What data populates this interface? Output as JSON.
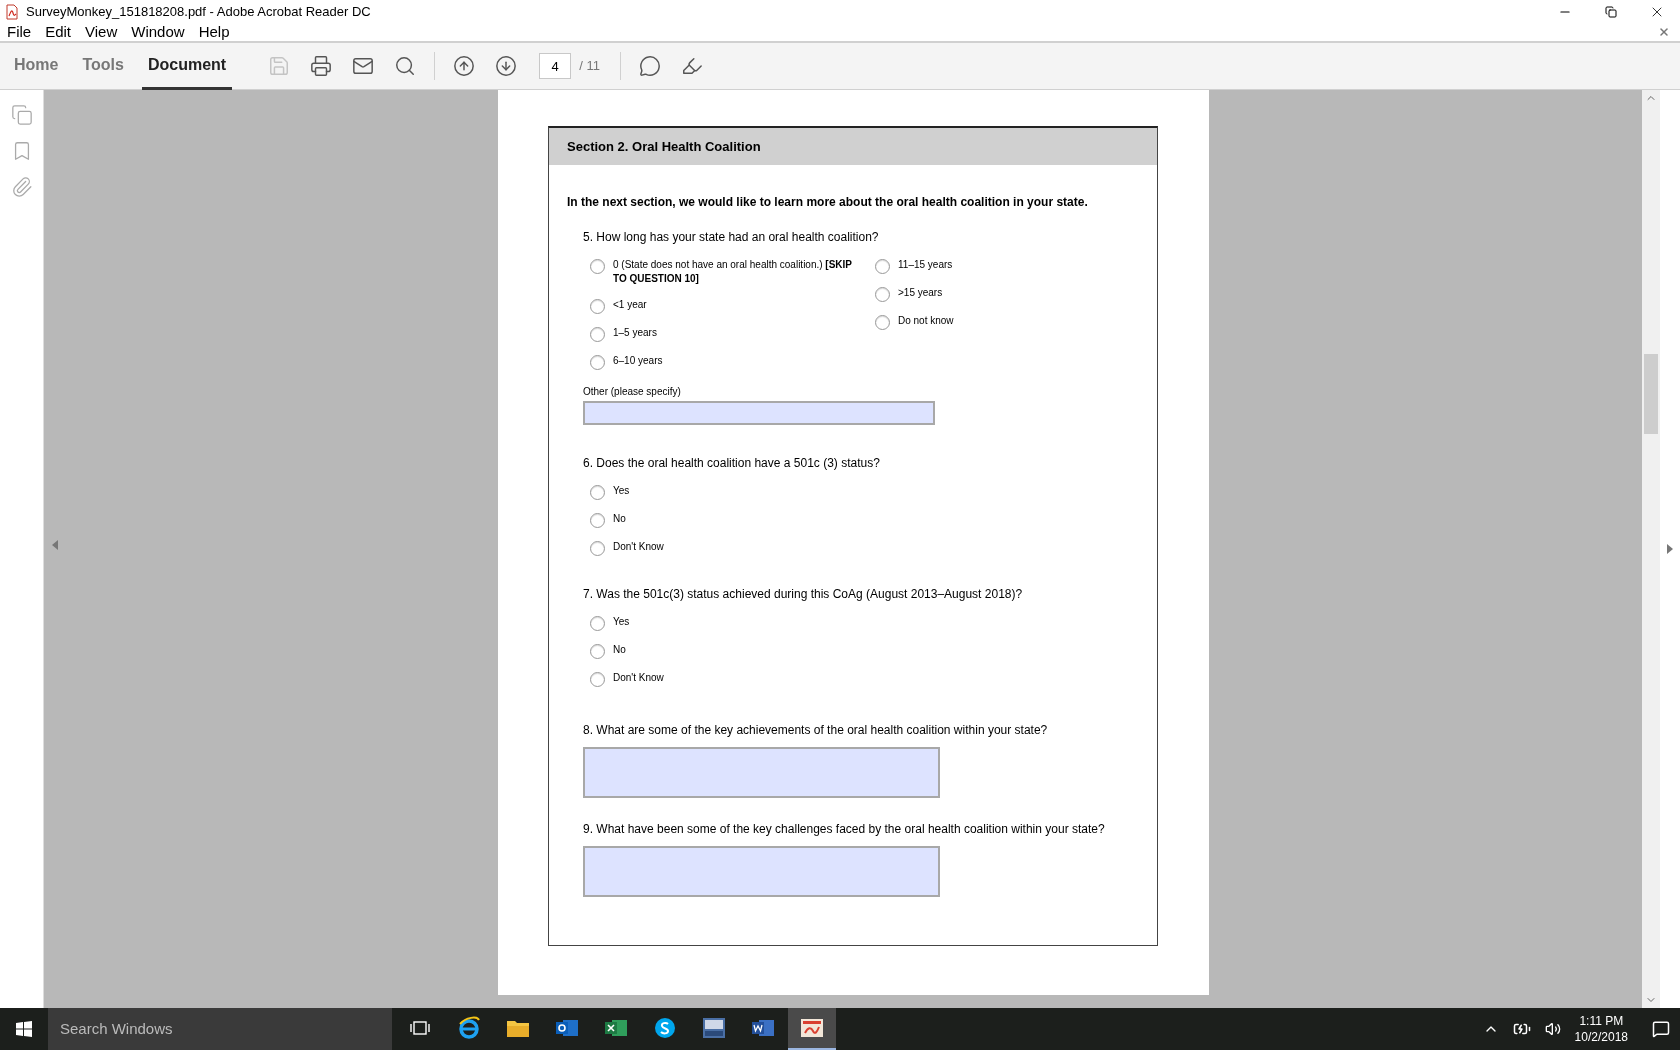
{
  "window": {
    "title": "SurveyMonkey_151818208.pdf - Adobe Acrobat Reader DC"
  },
  "menu": [
    "File",
    "Edit",
    "View",
    "Window",
    "Help"
  ],
  "tabs": [
    {
      "label": "Home",
      "selected": false
    },
    {
      "label": "Tools",
      "selected": false
    },
    {
      "label": "Document",
      "selected": true
    }
  ],
  "tools": [
    {
      "kind": "save",
      "disabled": true
    },
    {
      "kind": "print",
      "disabled": false
    },
    {
      "kind": "mail",
      "disabled": false
    },
    {
      "kind": "search",
      "disabled": false
    },
    {
      "kind": "up",
      "disabled": false
    },
    {
      "kind": "down",
      "disabled": false
    },
    {
      "kind": "page"
    },
    {
      "kind": "comment",
      "disabled": false
    },
    {
      "kind": "highlight",
      "disabled": false
    }
  ],
  "page": {
    "current": "4",
    "total": "/ 11"
  },
  "document": {
    "section_title": "Section 2. Oral Health Coalition",
    "intro": "In the next section, we would like to learn more about the oral health coalition in your state.",
    "questions": [
      {
        "kind": "radio",
        "text": "5. How long has your state had an oral health coalition?",
        "columns": [
          [
            {
              "label": "0 (State does not have an oral health coalition.) **[SKIP TO QUESTION 10]**",
              "selected": false
            },
            {
              "label": "<1 year",
              "selected": false
            },
            {
              "label": "1–5 years",
              "selected": false
            },
            {
              "label": "6–10 years",
              "selected": false
            }
          ],
          [
            {
              "label": "11–15 years",
              "selected": false
            },
            {
              "label": ">15 years",
              "selected": false
            },
            {
              "label": "Do not know",
              "selected": false
            }
          ]
        ],
        "other_label": "Other (please specify)"
      },
      {
        "kind": "radio",
        "text": "6. Does the oral health coalition have a 501c (3) status?",
        "columns": [
          [
            {
              "label": "Yes",
              "selected": false
            },
            {
              "label": "No",
              "selected": false
            },
            {
              "label": "Don't Know",
              "selected": false
            }
          ]
        ]
      },
      {
        "kind": "radio",
        "text": "7. Was the 501c(3) status achieved during this CoAg (August 2013–August 2018)?",
        "columns": [
          [
            {
              "label": "Yes",
              "selected": false
            },
            {
              "label": "No",
              "selected": false
            },
            {
              "label": "Don't Know",
              "selected": false
            }
          ]
        ]
      },
      {
        "kind": "essay",
        "text": "8. What are some of the key achievements of the oral health coalition within your state?"
      },
      {
        "kind": "essay",
        "text": "9. What have been some of the key challenges faced by the oral health coalition within your state?"
      }
    ]
  },
  "taskbar": {
    "search_placeholder": "Search Windows",
    "apps": [
      {
        "kind": "taskview",
        "selected": false
      },
      {
        "kind": "browser",
        "selected": false
      },
      {
        "kind": "folder",
        "selected": false
      },
      {
        "kind": "mail",
        "selected": false
      },
      {
        "kind": "sheet",
        "selected": false
      },
      {
        "kind": "chat",
        "selected": false
      },
      {
        "kind": "stats",
        "selected": false
      },
      {
        "kind": "doc",
        "selected": false
      },
      {
        "kind": "pdf",
        "selected": true
      }
    ],
    "time": "1:11 PM",
    "date": "10/2/2018"
  }
}
